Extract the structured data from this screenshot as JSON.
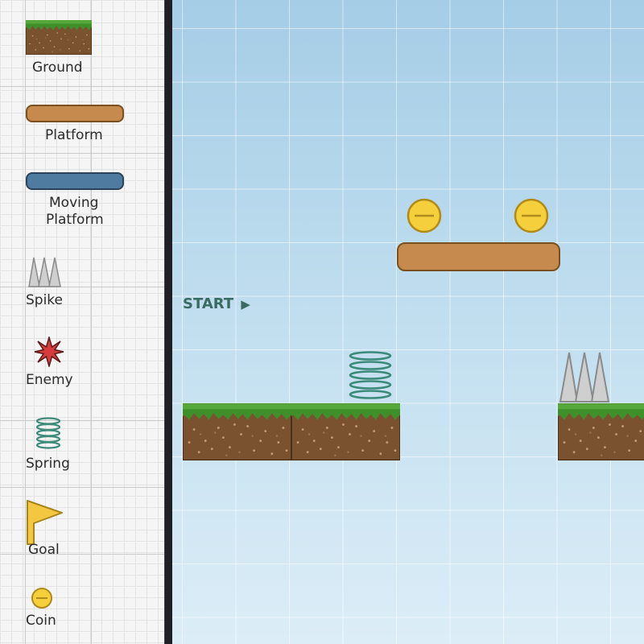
{
  "palette": {
    "items": [
      {
        "id": "ground",
        "label": "Ground",
        "icon": "ground-tile-icon"
      },
      {
        "id": "platform",
        "label": "Platform",
        "icon": "platform-icon"
      },
      {
        "id": "moving_platform",
        "label": "Moving Platform",
        "label_line1": "Moving",
        "label_line2": "Platform",
        "icon": "moving-platform-icon"
      },
      {
        "id": "spike",
        "label": "Spike",
        "icon": "spike-icon"
      },
      {
        "id": "enemy",
        "label": "Enemy",
        "icon": "enemy-icon"
      },
      {
        "id": "spring",
        "label": "Spring",
        "icon": "spring-icon"
      },
      {
        "id": "goal",
        "label": "Goal",
        "icon": "goal-flag-icon"
      },
      {
        "id": "coin",
        "label": "Coin",
        "icon": "coin-icon"
      }
    ]
  },
  "level": {
    "start_label": "START",
    "start_glyph": "▶",
    "objects": [
      "ground",
      "ground",
      "spring",
      "platform",
      "coin",
      "coin",
      "spike",
      "ground"
    ]
  },
  "colors": {
    "grass": "#3f8f2a",
    "dirt": "#7a5230",
    "platform": "#c68a4e",
    "moving_platform": "#4f7ba0",
    "coin": "#f6cf3d",
    "spring": "#3c8a7a",
    "spike": "#c8c8c8",
    "enemy": "#d73c3c",
    "goal": "#f3c742",
    "start_text": "#3a6b62",
    "sky_top": "#a5cde6",
    "sky_bottom": "#dcedf7"
  }
}
